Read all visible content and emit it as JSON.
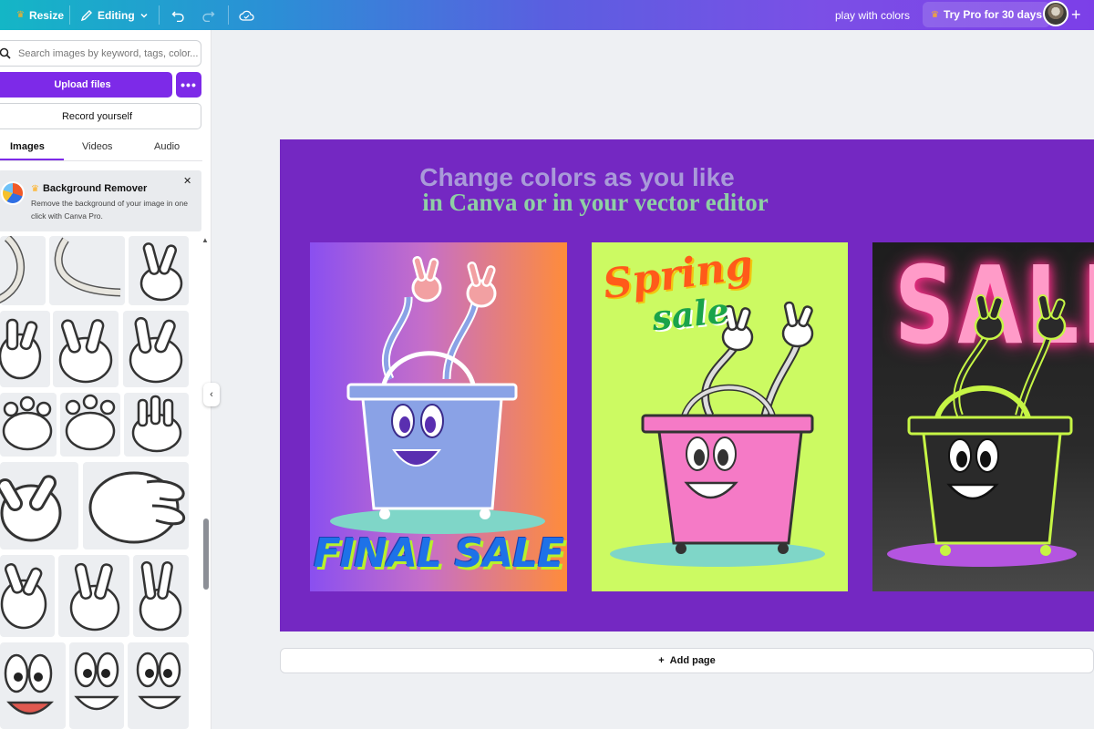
{
  "topbar": {
    "resize_label": "Resize",
    "editing_label": "Editing",
    "project_title": "play with colors",
    "pro_label": "Try Pro for 30 days",
    "plus_label": "+"
  },
  "panel": {
    "search_placeholder": "Search images by keyword, tags, color...",
    "upload_label": "Upload files",
    "more_label": "•••",
    "record_label": "Record yourself",
    "tabs": [
      "Images",
      "Videos",
      "Audio"
    ],
    "banner": {
      "title": "Background Remover",
      "description": "Remove the background of your image in one click with Canva Pro."
    }
  },
  "canvas": {
    "heading_line1": "Change colors as you like",
    "heading_line2": "in Canva or in your vector editor",
    "posters": [
      {
        "text": "FINAL SALE",
        "body_color": "#8aa2e6",
        "bg": "gradient purple-orange"
      },
      {
        "text_a": "Spring",
        "text_b": "sale",
        "body_color": "#f57ac6",
        "bg": "#ccfa62"
      },
      {
        "text": "SALE",
        "body_color": "#2a2a2a",
        "bg": "dark"
      }
    ]
  },
  "add_page_label": "Add page",
  "colors": {
    "accent": "#7d2ae8",
    "canvas_bg": "#7428c2"
  }
}
